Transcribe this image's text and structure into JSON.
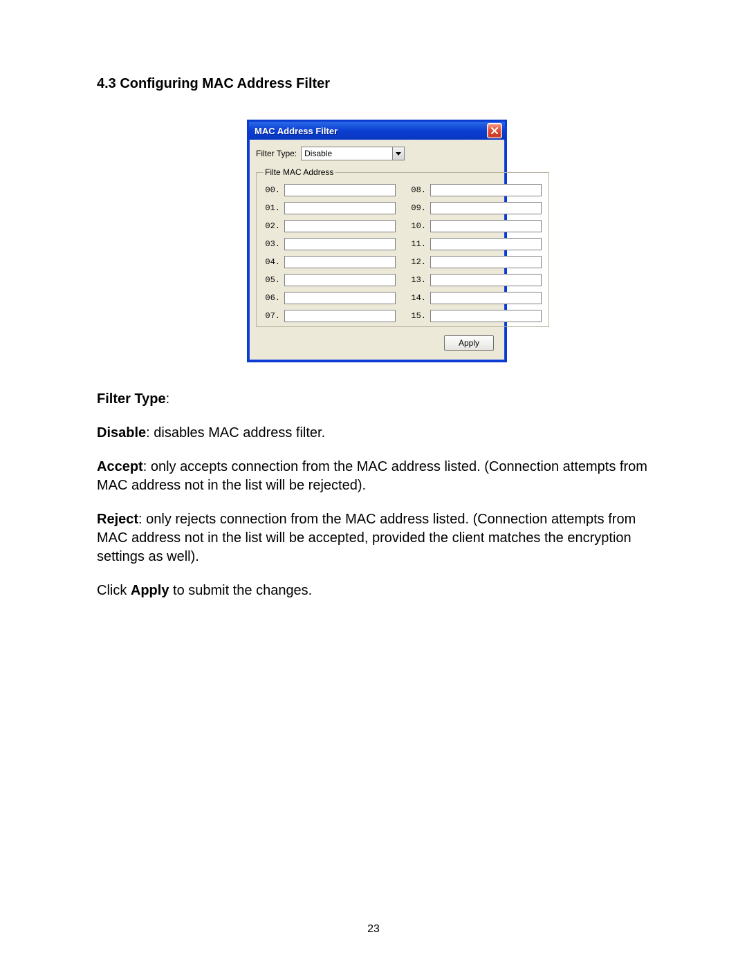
{
  "heading": "4.3 Configuring MAC Address Filter",
  "dialog": {
    "title": "MAC Address Filter",
    "filter_type_label": "Filter Type:",
    "filter_type_value": "Disable",
    "fieldset_legend": "Filte MAC Address",
    "entries": [
      {
        "idx": "00.",
        "value": ""
      },
      {
        "idx": "01.",
        "value": ""
      },
      {
        "idx": "02.",
        "value": ""
      },
      {
        "idx": "03.",
        "value": ""
      },
      {
        "idx": "04.",
        "value": ""
      },
      {
        "idx": "05.",
        "value": ""
      },
      {
        "idx": "06.",
        "value": ""
      },
      {
        "idx": "07.",
        "value": ""
      },
      {
        "idx": "08.",
        "value": ""
      },
      {
        "idx": "09.",
        "value": ""
      },
      {
        "idx": "10.",
        "value": ""
      },
      {
        "idx": "11.",
        "value": ""
      },
      {
        "idx": "12.",
        "value": ""
      },
      {
        "idx": "13.",
        "value": ""
      },
      {
        "idx": "14.",
        "value": ""
      },
      {
        "idx": "15.",
        "value": ""
      }
    ],
    "apply_label": "Apply"
  },
  "descriptions": {
    "filter_type_heading": "Filter Type",
    "colon": ":",
    "disable_term": "Disable",
    "disable_text": ": disables MAC address filter.",
    "accept_term": "Accept",
    "accept_text": ": only accepts connection from the MAC address listed. (Connection attempts from MAC address not in the list will be rejected).",
    "reject_term": "Reject",
    "reject_text": ": only rejects connection from the MAC address listed. (Connection attempts from MAC address not in the list will be accepted, provided the client matches the encryption settings as well).",
    "click_prefix": "Click ",
    "apply_word": "Apply",
    "click_suffix": " to submit the changes."
  },
  "page_number": "23"
}
